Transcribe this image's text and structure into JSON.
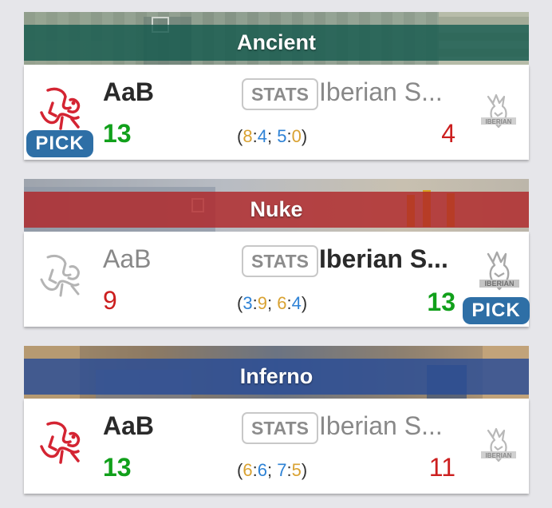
{
  "maps": [
    {
      "name": "Ancient",
      "stats_label": "STATS",
      "team1": {
        "name": "AaB",
        "score": "13",
        "logo": "aab-horse-logo"
      },
      "team2": {
        "name": "Iberian S...",
        "score": "4",
        "logo": "iberian-lion-logo"
      },
      "halves": {
        "open": "(",
        "h1a": "8",
        "sep1": ":",
        "h1b": "4",
        "semi": "; ",
        "h2a": "5",
        "sep2": ":",
        "h2b": "0",
        "close": ")"
      },
      "pick_label": "PICK",
      "picked_by": "team1",
      "winner": "team1"
    },
    {
      "name": "Nuke",
      "stats_label": "STATS",
      "team1": {
        "name": "AaB",
        "score": "9",
        "logo": "aab-horse-logo"
      },
      "team2": {
        "name": "Iberian S...",
        "score": "13",
        "logo": "iberian-lion-logo"
      },
      "halves": {
        "open": "(",
        "h1a": "3",
        "sep1": ":",
        "h1b": "9",
        "semi": "; ",
        "h2a": "6",
        "sep2": ":",
        "h2b": "4",
        "close": ")"
      },
      "pick_label": "PICK",
      "picked_by": "team2",
      "winner": "team2"
    },
    {
      "name": "Inferno",
      "stats_label": "STATS",
      "team1": {
        "name": "AaB",
        "score": "13",
        "logo": "aab-horse-logo"
      },
      "team2": {
        "name": "Iberian S...",
        "score": "11",
        "logo": "iberian-lion-logo"
      },
      "halves": {
        "open": "(",
        "h1a": "6",
        "sep1": ":",
        "h1b": "6",
        "semi": "; ",
        "h2a": "7",
        "sep2": ":",
        "h2b": "5",
        "close": ")"
      },
      "pick_label": "",
      "picked_by": "none",
      "winner": "team1"
    }
  ],
  "colors": {
    "win": "#11a01b",
    "loss": "#cc1f1f",
    "ct_side": "#2f83d6",
    "t_side": "#d9a232",
    "pick_badge": "#2e6fa6",
    "ancient_strip": "#165a4e",
    "nuke_strip": "#b02628",
    "inferno_strip": "#284c96"
  }
}
